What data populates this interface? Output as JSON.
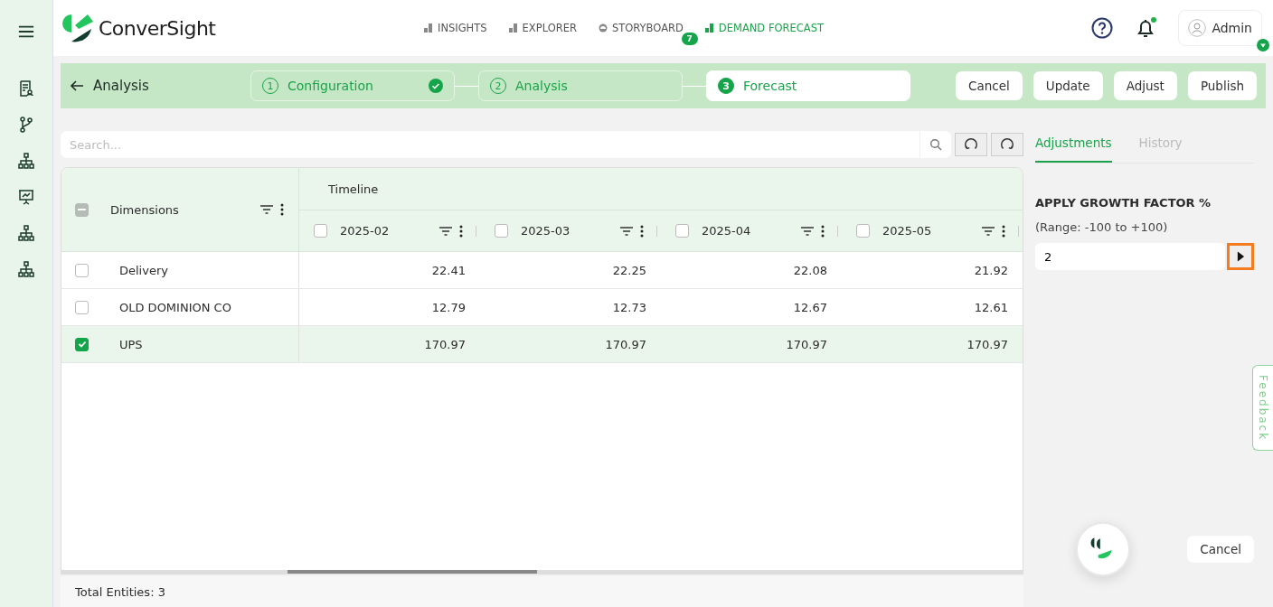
{
  "brand": {
    "name": "ConverSight"
  },
  "nav": [
    {
      "label": "INSIGHTS",
      "selected": false,
      "kind": "chart"
    },
    {
      "label": "EXPLORER",
      "selected": false,
      "kind": "chart"
    },
    {
      "label": "STORYBOARD",
      "selected": false,
      "kind": "gauge",
      "badge": "7"
    },
    {
      "label": "DEMAND FORECAST",
      "selected": true,
      "kind": "chart"
    }
  ],
  "user": {
    "name": "Admin",
    "has_notification": true
  },
  "toolbar": {
    "back_label": "Analysis",
    "steps": [
      {
        "number": "1",
        "label": "Configuration",
        "completed": true,
        "selected": false
      },
      {
        "number": "2",
        "label": "Analysis",
        "completed": false,
        "selected": false
      },
      {
        "number": "3",
        "label": "Forecast",
        "completed": false,
        "selected": true
      }
    ],
    "buttons": [
      "Cancel",
      "Update",
      "Adjust",
      "Publish"
    ]
  },
  "search": {
    "placeholder": "Search..."
  },
  "table": {
    "select_all_indeterminate": true,
    "dimension_header": "Dimensions",
    "group_header": "Timeline",
    "columns": [
      {
        "label": "2025-02",
        "checked": false
      },
      {
        "label": "2025-03",
        "checked": false
      },
      {
        "label": "2025-04",
        "checked": false
      },
      {
        "label": "2025-05",
        "checked": false
      }
    ],
    "rows": [
      {
        "name": "Delivery",
        "checked": false,
        "values": [
          "22.41",
          "22.25",
          "22.08",
          "21.92"
        ]
      },
      {
        "name": "OLD DOMINION CO",
        "checked": false,
        "values": [
          "12.79",
          "12.73",
          "12.67",
          "12.61"
        ]
      },
      {
        "name": "UPS",
        "checked": true,
        "values": [
          "170.97",
          "170.97",
          "170.97",
          "170.97"
        ]
      }
    ],
    "footer": "Total Entities: 3"
  },
  "panel": {
    "tabs": [
      {
        "label": "Adjustments",
        "selected": true
      },
      {
        "label": "History",
        "selected": false
      }
    ],
    "heading": "APPLY GROWTH FACTOR %",
    "range": "(Range: -100 to +100)",
    "value": "2",
    "cancel": "Cancel"
  },
  "feedback": "Feedback"
}
